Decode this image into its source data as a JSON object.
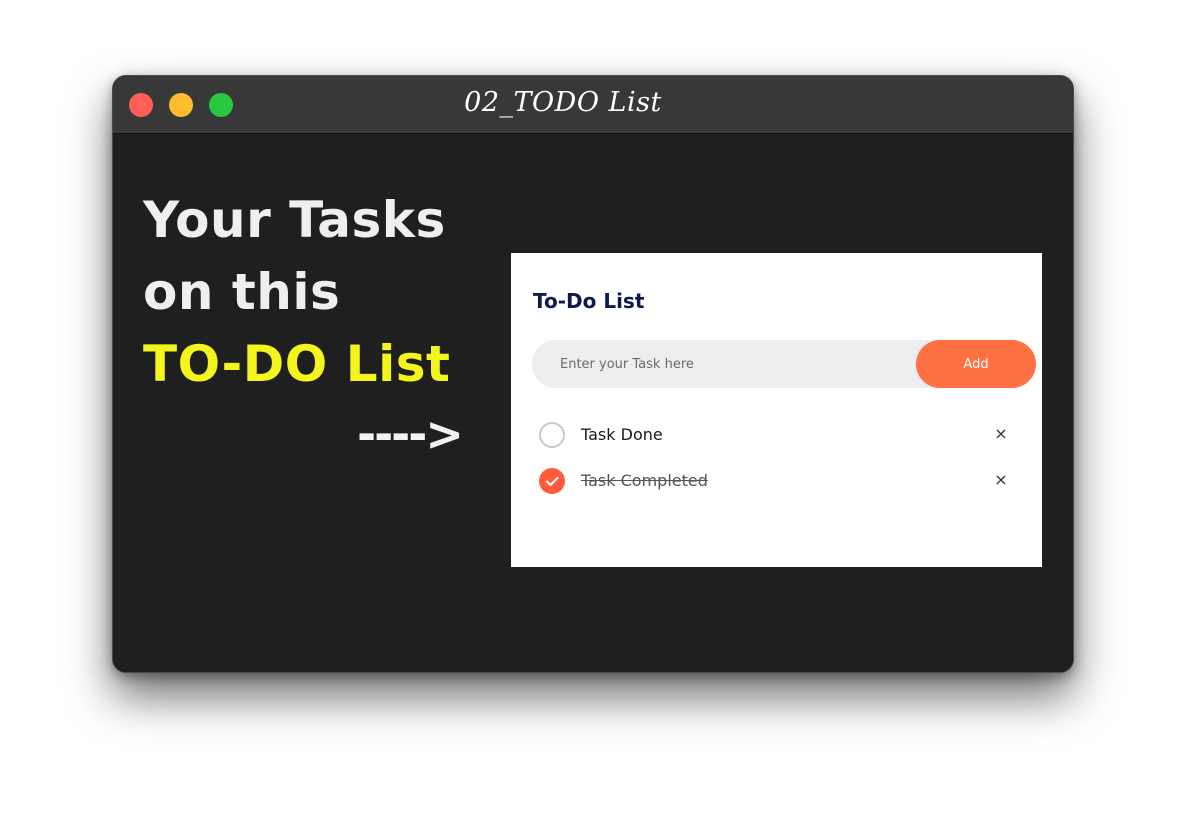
{
  "window": {
    "title": "02_TODO List",
    "controls": [
      "close",
      "minimize",
      "maximize"
    ]
  },
  "headline": {
    "line1": "Your Tasks",
    "line2": "on this",
    "line3": "TO-DO List",
    "arrow": "---->"
  },
  "todo": {
    "title": "To-Do List",
    "input_placeholder": "Enter your Task here",
    "input_value": "",
    "add_label": "Add",
    "tasks": [
      {
        "label": "Task Done",
        "checked": false,
        "delete_symbol": "×"
      },
      {
        "label": "Task Completed",
        "checked": true,
        "delete_symbol": "×"
      }
    ]
  },
  "colors": {
    "window_bg": "#1f1f1f",
    "titlebar_bg": "#383838",
    "headline_white": "#efefef",
    "headline_yellow": "#f5f51e",
    "accent_orange": "#ff7043",
    "checked_red": "#ff5a3c",
    "todo_title": "#0d1b4c"
  },
  "icons": {
    "close": "traffic-light-red",
    "minimize": "traffic-light-yellow",
    "maximize": "traffic-light-green",
    "unchecked": "empty-circle",
    "checked": "checkmark-circle",
    "delete": "close-x"
  }
}
